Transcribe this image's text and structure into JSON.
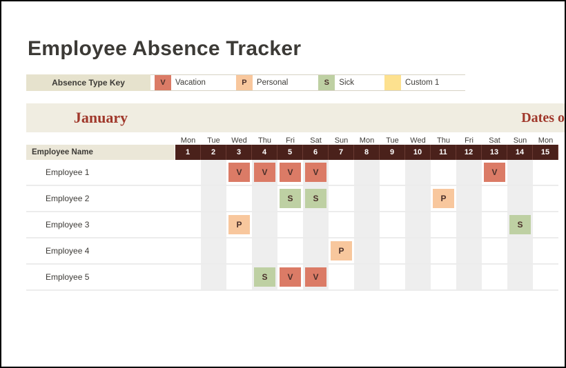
{
  "title": "Employee Absence Tracker",
  "legend": {
    "label": "Absence Type Key",
    "items": [
      {
        "code": "V",
        "text": "Vacation",
        "cls": "sw-v"
      },
      {
        "code": "P",
        "text": "Personal",
        "cls": "sw-p"
      },
      {
        "code": "S",
        "text": "Sick",
        "cls": "sw-s"
      },
      {
        "code": "",
        "text": "Custom 1",
        "cls": "sw-c"
      }
    ]
  },
  "month": {
    "name": "January",
    "right_label": "Dates o"
  },
  "days": [
    {
      "dow": "Mon",
      "num": "1"
    },
    {
      "dow": "Tue",
      "num": "2"
    },
    {
      "dow": "Wed",
      "num": "3"
    },
    {
      "dow": "Thu",
      "num": "4"
    },
    {
      "dow": "Fri",
      "num": "5"
    },
    {
      "dow": "Sat",
      "num": "6"
    },
    {
      "dow": "Sun",
      "num": "7"
    },
    {
      "dow": "Mon",
      "num": "8"
    },
    {
      "dow": "Tue",
      "num": "9"
    },
    {
      "dow": "Wed",
      "num": "10"
    },
    {
      "dow": "Thu",
      "num": "11"
    },
    {
      "dow": "Fri",
      "num": "12"
    },
    {
      "dow": "Sat",
      "num": "13"
    },
    {
      "dow": "Sun",
      "num": "14"
    },
    {
      "dow": "Mon",
      "num": "15"
    }
  ],
  "name_header": "Employee Name",
  "employees": [
    {
      "name": "Employee 1",
      "absences": {
        "3": "V",
        "4": "V",
        "5": "V",
        "6": "V",
        "13": "V"
      }
    },
    {
      "name": "Employee 2",
      "absences": {
        "5": "S",
        "6": "S",
        "11": "P"
      }
    },
    {
      "name": "Employee 3",
      "absences": {
        "3": "P",
        "14": "S"
      }
    },
    {
      "name": "Employee 4",
      "absences": {
        "7": "P"
      }
    },
    {
      "name": "Employee 5",
      "absences": {
        "4": "S",
        "5": "V",
        "6": "V"
      }
    }
  ],
  "badge_class": {
    "V": "b-v",
    "P": "b-p",
    "S": "b-s"
  }
}
